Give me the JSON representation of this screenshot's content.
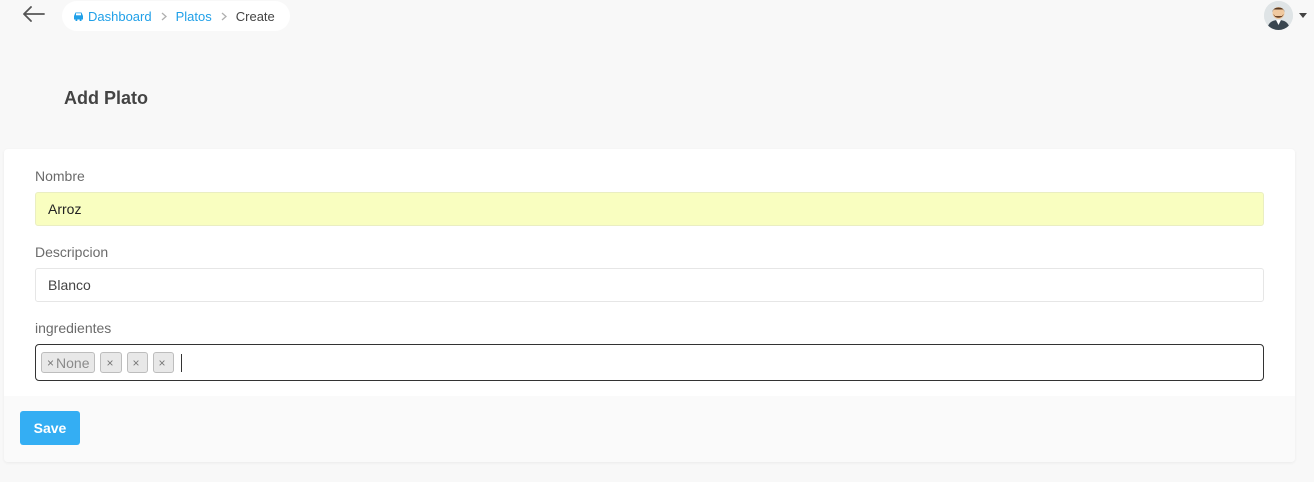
{
  "breadcrumb": {
    "items": [
      {
        "label": "Dashboard",
        "icon": "car-icon"
      },
      {
        "label": "Platos"
      },
      {
        "label": "Create"
      }
    ]
  },
  "header": {
    "avatar_icon": "user-avatar-icon"
  },
  "page": {
    "title": "Add Plato"
  },
  "form": {
    "nombre": {
      "label": "Nombre",
      "value": "Arroz"
    },
    "descripcion": {
      "label": "Descripcion",
      "value": "Blanco"
    },
    "ingredientes": {
      "label": "ingredientes",
      "tags": [
        "None",
        "",
        "",
        ""
      ],
      "remove_glyph": "×"
    },
    "save_label": "Save"
  },
  "colors": {
    "accent": "#34aef3",
    "link": "#20a0e8",
    "autofill": "#f9fec0"
  }
}
